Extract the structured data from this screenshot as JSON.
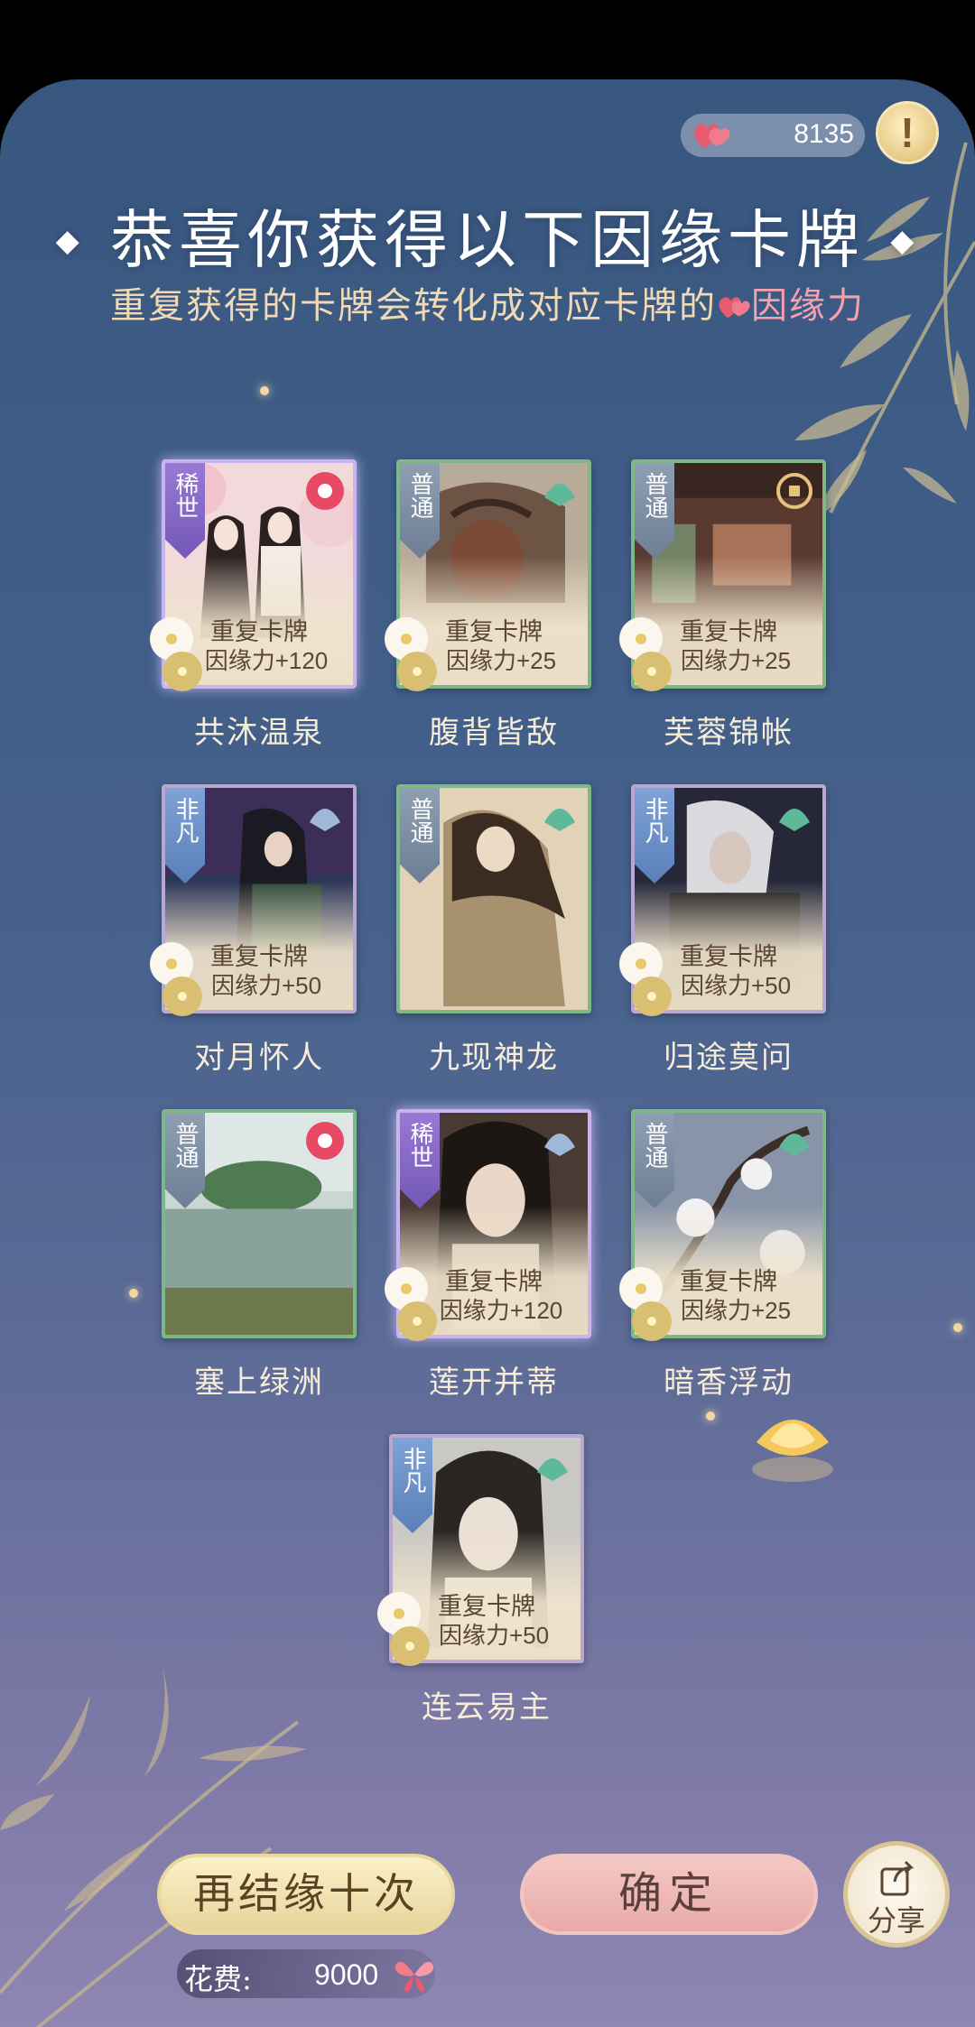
{
  "header": {
    "currency_value": "8135",
    "title": "恭喜你获得以下因缘卡牌",
    "subtitle_prefix": "重复获得的卡牌会转化成对应卡牌的",
    "subtitle_highlight": "因缘力"
  },
  "dup_line1": "重复卡牌",
  "cards": [
    {
      "name": "共沐温泉",
      "rarity": "稀世",
      "dup_bonus": "因缘力+120",
      "rarity_color": "#8a6bc9"
    },
    {
      "name": "腹背皆敌",
      "rarity": "普通",
      "dup_bonus": "因缘力+25",
      "rarity_color": "#7d8ea6"
    },
    {
      "name": "芙蓉锦帐",
      "rarity": "普通",
      "dup_bonus": "因缘力+25",
      "rarity_color": "#7d8ea6"
    },
    {
      "name": "对月怀人",
      "rarity": "非凡",
      "dup_bonus": "因缘力+50",
      "rarity_color": "#6b90c8"
    },
    {
      "name": "九现神龙",
      "rarity": "普通",
      "dup_bonus": "",
      "rarity_color": "#7d8ea6"
    },
    {
      "name": "归途莫问",
      "rarity": "非凡",
      "dup_bonus": "因缘力+50",
      "rarity_color": "#6b90c8"
    },
    {
      "name": "塞上绿洲",
      "rarity": "普通",
      "dup_bonus": "",
      "rarity_color": "#7d8ea6"
    },
    {
      "name": "莲开并蒂",
      "rarity": "稀世",
      "dup_bonus": "因缘力+120",
      "rarity_color": "#8a6bc9"
    },
    {
      "name": "暗香浮动",
      "rarity": "普通",
      "dup_bonus": "因缘力+25",
      "rarity_color": "#7d8ea6"
    },
    {
      "name": "连云易主",
      "rarity": "非凡",
      "dup_bonus": "因缘力+50",
      "rarity_color": "#6b90c8"
    }
  ],
  "buttons": {
    "draw_again": "再结缘十次",
    "confirm": "确定",
    "share": "分享"
  },
  "cost": {
    "label": "花费:",
    "value": "9000"
  },
  "colors": {
    "title_gold": "#f0d9b4",
    "highlight_pink": "#f5a0ad",
    "background_top": "#38577f",
    "background_bottom": "#8f86b2"
  }
}
